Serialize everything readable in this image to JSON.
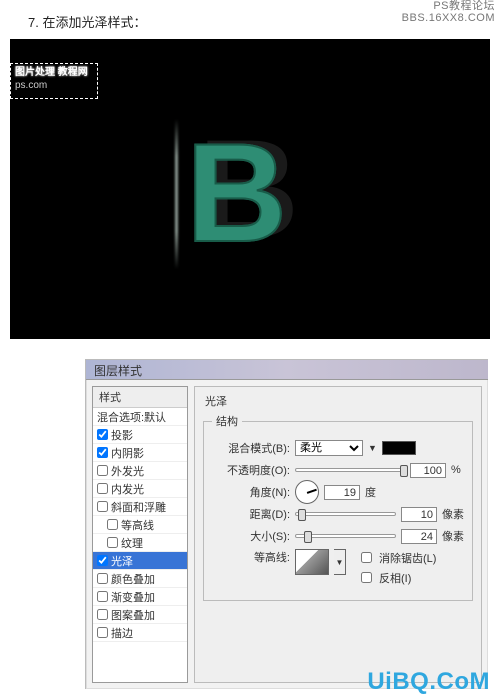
{
  "watermark_top": {
    "line1": "PS教程论坛",
    "line2": "BBS.16XX8.COM"
  },
  "step": "7. 在添加光泽样式：",
  "canvas": {
    "wm_line1": "图片处理 教程网",
    "wm_line2": "ps.com",
    "letter": "B"
  },
  "dialog": {
    "title": "图层样式",
    "list_header": "样式",
    "items": [
      {
        "label": "混合选项:默认",
        "checked": null,
        "selected": false,
        "indent": false
      },
      {
        "label": "投影",
        "checked": true,
        "selected": false,
        "indent": false
      },
      {
        "label": "内阴影",
        "checked": true,
        "selected": false,
        "indent": false
      },
      {
        "label": "外发光",
        "checked": false,
        "selected": false,
        "indent": false
      },
      {
        "label": "内发光",
        "checked": false,
        "selected": false,
        "indent": false
      },
      {
        "label": "斜面和浮雕",
        "checked": false,
        "selected": false,
        "indent": false
      },
      {
        "label": "等高线",
        "checked": false,
        "selected": false,
        "indent": true
      },
      {
        "label": "纹理",
        "checked": false,
        "selected": false,
        "indent": true
      },
      {
        "label": "光泽",
        "checked": true,
        "selected": true,
        "indent": false
      },
      {
        "label": "颜色叠加",
        "checked": false,
        "selected": false,
        "indent": false
      },
      {
        "label": "渐变叠加",
        "checked": false,
        "selected": false,
        "indent": false
      },
      {
        "label": "图案叠加",
        "checked": false,
        "selected": false,
        "indent": false
      },
      {
        "label": "描边",
        "checked": false,
        "selected": false,
        "indent": false
      }
    ],
    "panel": {
      "section_title": "光泽",
      "group_title": "结构",
      "blend_label": "混合模式(B):",
      "blend_value": "柔光",
      "color": "#000000",
      "opacity_label": "不透明度(O):",
      "opacity_value": "100",
      "opacity_unit": "%",
      "angle_label": "角度(N):",
      "angle_value": "19",
      "angle_unit": "度",
      "distance_label": "距离(D):",
      "distance_value": "10",
      "distance_unit": "像素",
      "size_label": "大小(S):",
      "size_value": "24",
      "size_unit": "像素",
      "contour_label": "等高线:",
      "antialias_label": "消除锯齿(L)",
      "antialias_checked": false,
      "invert_label": "反相(I)",
      "invert_checked": false
    }
  },
  "logo": "UiBQ.CoM"
}
